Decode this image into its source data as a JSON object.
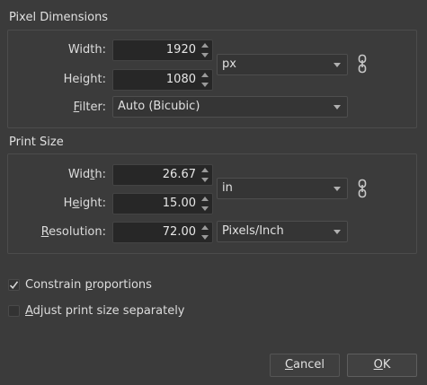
{
  "pixel_dimensions": {
    "title": "Pixel Dimensions",
    "width_label": "Width:",
    "width_value": "1920",
    "height_label": "Height:",
    "height_value": "1080",
    "unit": "px",
    "filter_label": "Filter:",
    "filter_value": "Auto (Bicubic)"
  },
  "print_size": {
    "title": "Print Size",
    "width_label": "Width:",
    "width_value": "26.67",
    "height_label": "Height:",
    "height_value": "15.00",
    "unit": "in",
    "resolution_label": "Resolution:",
    "resolution_value": "72.00",
    "resolution_unit": "Pixels/Inch"
  },
  "options": {
    "constrain_label": "Constrain proportions",
    "constrain_checked": true,
    "adjust_label": "Adjust print size separately",
    "adjust_checked": false
  },
  "buttons": {
    "cancel": "Cancel",
    "ok": "OK"
  }
}
